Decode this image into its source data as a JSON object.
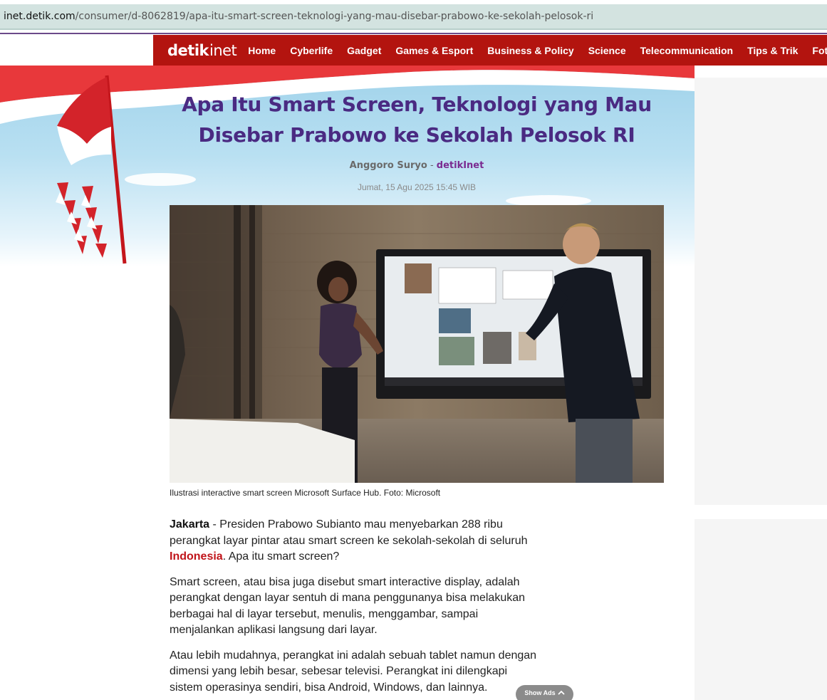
{
  "browser": {
    "url_host": "inet.detik.com",
    "url_path": "/consumer/d-8062819/apa-itu-smart-screen-teknologi-yang-mau-disebar-prabowo-ke-sekolah-pelosok-ri"
  },
  "nav": {
    "logo_bold": "detik",
    "logo_light": "inet",
    "items": [
      "Home",
      "Cyberlife",
      "Gadget",
      "Games & Esport",
      "Business & Policy",
      "Science",
      "Telecommunication",
      "Tips & Trik",
      "Foto"
    ]
  },
  "article": {
    "title": "Apa Itu Smart Screen, Teknologi yang Mau Disebar Prabowo ke Sekolah Pelosok RI",
    "author": "Anggoro Suryo",
    "separator": " - ",
    "source": "detikInet",
    "date": "Jumat, 15 Agu 2025 15:45 WIB",
    "photo_caption": "Ilustrasi interactive smart screen Microsoft Surface Hub. Foto: Microsoft",
    "p1_city": "Jakarta",
    "p1_text_a": " - Presiden Prabowo Subianto mau menyebarkan 288 ribu perangkat layar pintar atau smart screen ke sekolah-sekolah di seluruh ",
    "p1_link": "Indonesia",
    "p1_text_b": ". Apa itu smart screen?",
    "p2": "Smart screen, atau bisa juga disebut smart interactive display, adalah perangkat dengan layar sentuh di mana penggunanya bisa melakukan berbagai hal di layar tersebut, menulis, menggambar, sampai menjalankan aplikasi langsung dari layar.",
    "p3": "Atau lebih mudahnya, perangkat ini adalah sebuah tablet namun dengan dimensi yang lebih besar, sebesar televisi. Perangkat ini dilengkapi sistem operasinya sendiri, bisa Android, Windows, dan lainnya."
  },
  "ads": {
    "show_label": "Show Ads",
    "chevron_icon": "chevron-up-icon"
  },
  "colors": {
    "nav_red": "#b3140f",
    "title_purple": "#4a2a82",
    "link_red": "#c0141a"
  }
}
